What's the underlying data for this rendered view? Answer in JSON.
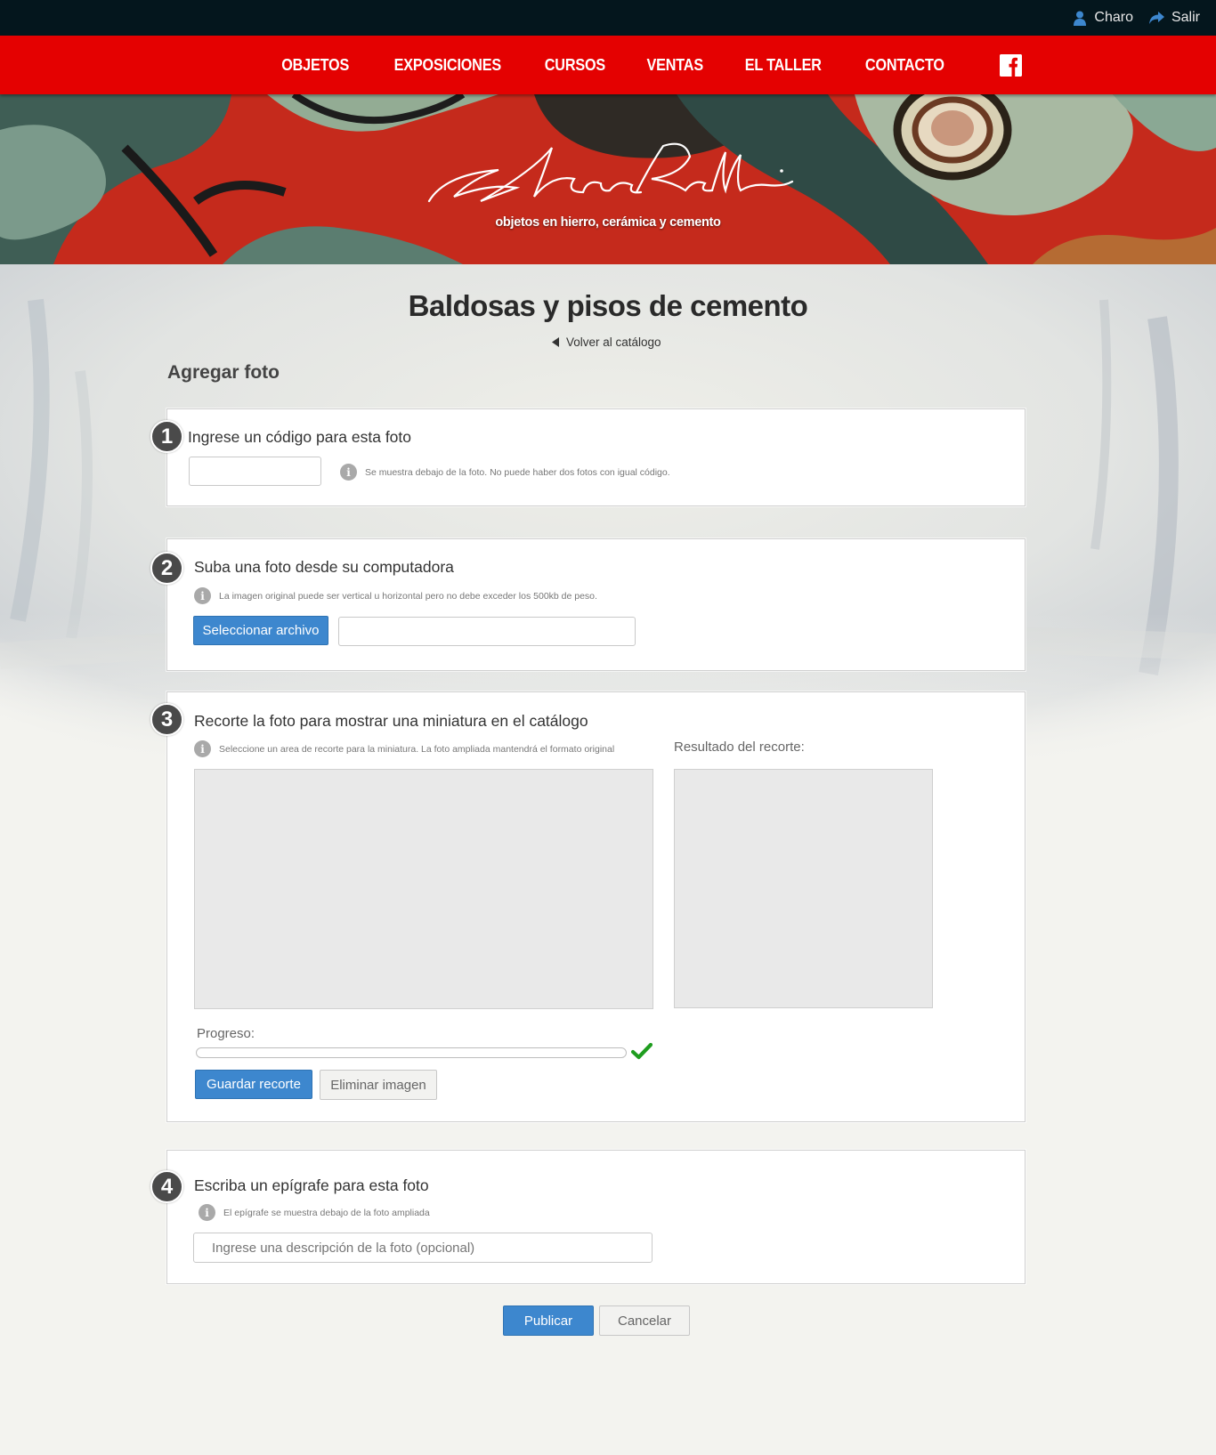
{
  "topbar": {
    "user_label": "Charo",
    "logout_label": "Salir"
  },
  "nav": {
    "items": [
      "OBJETOS",
      "EXPOSICIONES",
      "CURSOS",
      "VENTAS",
      "EL TALLER",
      "CONTACTO"
    ]
  },
  "hero": {
    "logo_text": "Charo Perelli",
    "tagline": "objetos en hierro, cerámica y cemento"
  },
  "page": {
    "title": "Baldosas y pisos de cemento",
    "back_link": "Volver al catálogo",
    "section_title": "Agregar foto"
  },
  "steps": {
    "step1": {
      "number": "1",
      "title": "Ingrese un código para esta foto",
      "code_value": "",
      "hint": "Se muestra debajo de la foto. No puede haber dos fotos con igual código."
    },
    "step2": {
      "number": "2",
      "title": "Suba una foto desde su computadora",
      "hint": "La imagen original puede ser vertical u horizontal pero no debe exceder los 500kb de peso.",
      "select_button": "Seleccionar archivo",
      "file_value": ""
    },
    "step3": {
      "number": "3",
      "title": "Recorte la foto para mostrar una miniatura en el catálogo",
      "hint": "Seleccione un area de recorte para la miniatura. La foto ampliada mantendrá el formato original",
      "result_label": "Resultado del recorte:",
      "progress_label": "Progreso:",
      "progress_value": 0,
      "save_button": "Guardar recorte",
      "delete_button": "Eliminar imagen"
    },
    "step4": {
      "number": "4",
      "title": "Escriba un epígrafe para esta foto",
      "hint": "El epígrafe se muestra debajo de la foto ampliada",
      "caption_placeholder": "Ingrese una descripción de la foto (opcional)"
    }
  },
  "actions": {
    "publish": "Publicar",
    "cancel": "Cancelar"
  },
  "colors": {
    "nav": "#e40101",
    "topbar": "#04161d",
    "primary": "#3d87ce",
    "check": "#1f9d1f"
  }
}
